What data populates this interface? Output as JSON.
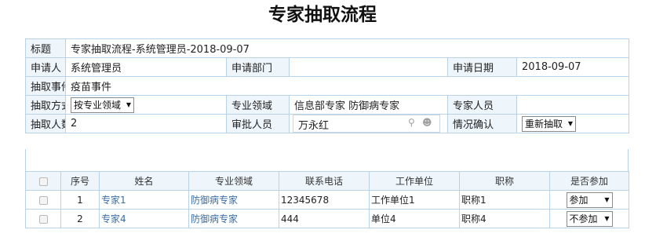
{
  "page_title": "专家抽取流程",
  "form": {
    "title_label": "标题",
    "title_value": "专家抽取流程-系统管理员-2018-09-07",
    "applicant_label": "申请人",
    "applicant_value": "系统管理员",
    "dept_label": "申请部门",
    "dept_value": "",
    "date_label": "申请日期",
    "date_value": "2018-09-07",
    "event_label": "抽取事件",
    "event_value": "疫苗事件",
    "method_label": "抽取方式",
    "method_value": "按专业领域",
    "field_label": "专业领域",
    "field_value": "信息部专家 防御病专家",
    "experts_label": "专家人员",
    "experts_value": "",
    "count_label": "抽取人数",
    "count_value": "2",
    "approver_label": "审批人员",
    "approver_value": "万永红",
    "confirm_label": "情况确认",
    "confirm_value": "重新抽取"
  },
  "grid": {
    "headers": [
      "序号",
      "姓名",
      "专业领域",
      "联系电话",
      "工作单位",
      "职称",
      "是否参加"
    ],
    "rows": [
      {
        "no": "1",
        "name": "专家1",
        "field": "防御病专家",
        "phone": "12345678",
        "unit": "工作单位1",
        "title": "职称1",
        "attend": "参加"
      },
      {
        "no": "2",
        "name": "专家4",
        "field": "防御病专家",
        "phone": "444",
        "unit": "单位4",
        "title": "职称4",
        "attend": "不参加"
      }
    ]
  },
  "icons": {
    "search": "search-icon",
    "user": "user-icon",
    "dropdown": "chevron-down-icon",
    "checkbox": "checkbox-icon"
  }
}
